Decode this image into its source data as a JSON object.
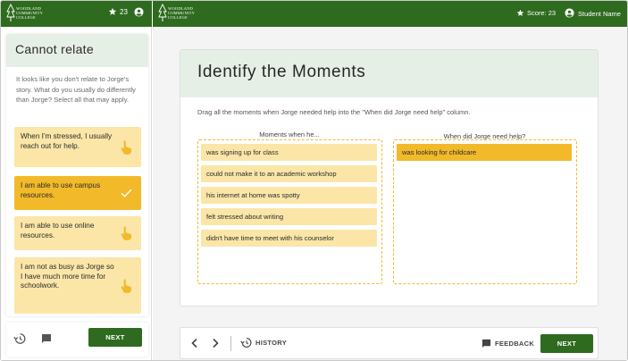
{
  "brand": {
    "logo_line1": "WOODLAND",
    "logo_line2": "COMMUNITY",
    "logo_line3": "COLLEGE"
  },
  "left": {
    "star_count": "23",
    "panel_title": "Cannot relate",
    "description": "It looks like you don't relate to Jorge's story. What do you usually do differently than Jorge? Select all that may apply.",
    "options": [
      {
        "label": "When I'm stressed, I usually reach out for help.",
        "selected": false,
        "icon": "hand-pointer-icon"
      },
      {
        "label": "I am able to use campus resources.",
        "selected": true,
        "icon": "check-icon"
      },
      {
        "label": "I am able to use online resources.",
        "selected": false,
        "icon": "hand-pointer-icon"
      },
      {
        "label": "I am not as busy as Jorge so I have much more time for schoolwork.",
        "selected": false,
        "icon": "hand-pointer-icon"
      }
    ],
    "next_label": "NEXT"
  },
  "header": {
    "score_label": "Score: 23",
    "student_name": "Student Name"
  },
  "activity": {
    "title": "Identify the Moments",
    "instruction": "Drag all the moments when Jorge needed help into the \"When did Jorge need help\" column.",
    "left_column_title": "Moments when he...",
    "right_column_title": "When did Jorge need help?",
    "left_items": [
      "was signing up for class",
      "could not make it to an academic workshop",
      "his internet at home was spotty",
      "felt stressed about writing",
      "didn't have time to meet with his counselor"
    ],
    "right_items": [
      "was looking for childcare"
    ]
  },
  "footer": {
    "history_label": "HISTORY",
    "feedback_label": "FEEDBACK",
    "next_label": "NEXT"
  },
  "colors": {
    "brand_green": "#2e6b1f",
    "chip_light": "#fbe6a8",
    "chip_selected": "#f2ba2a",
    "header_tint": "#e6efe6"
  }
}
